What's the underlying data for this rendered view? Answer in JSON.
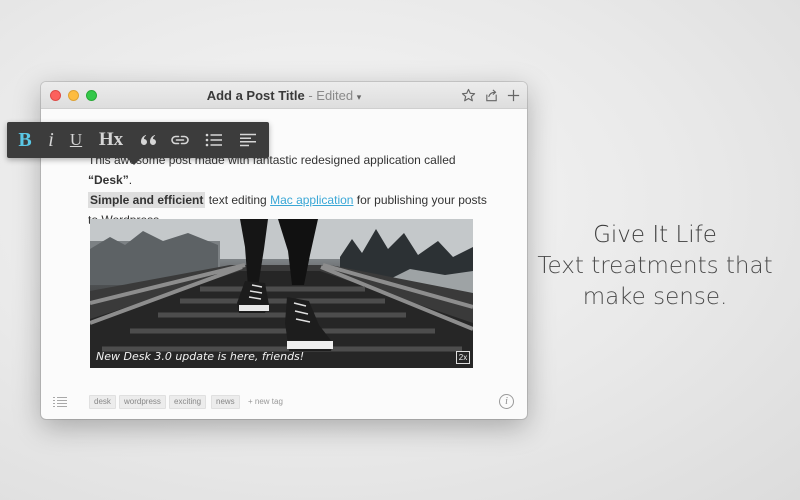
{
  "window": {
    "title": "Add a Post Title",
    "status": "- Edited",
    "status_caret": "▾",
    "titlebar_icons": [
      "star-icon",
      "share-icon",
      "plus-icon"
    ]
  },
  "format_toolbar": {
    "items": [
      {
        "name": "bold",
        "label": "B",
        "active": true
      },
      {
        "name": "italic",
        "label": "i"
      },
      {
        "name": "underline",
        "label": "U"
      },
      {
        "name": "heading",
        "label": "Hx"
      },
      {
        "name": "quote",
        "label": "quote-icon"
      },
      {
        "name": "link",
        "label": "link-icon"
      },
      {
        "name": "list",
        "label": "list-icon"
      },
      {
        "name": "align",
        "label": "align-left-icon"
      }
    ],
    "accent_color": "#5ac8e6"
  },
  "post": {
    "line1_start": "This awesome post made with fantastic redesigned application called ",
    "line1_bold": "“Desk”",
    "line1_end": ".",
    "highlight": "Simple and efficient",
    "mid_text": " text editing ",
    "link_text": "Mac application",
    "end_text": " for publishing your posts to Wordpress."
  },
  "image": {
    "caption": "New Desk 3.0 update is here, friends!",
    "badge": "2x"
  },
  "tags": {
    "items": [
      "desk",
      "wordpress",
      "exciting",
      "news"
    ],
    "new_tag_placeholder": "+ new tag"
  },
  "promo": {
    "headline": "Give It Life",
    "line2": "Text treatments that",
    "line3": "make sense."
  }
}
